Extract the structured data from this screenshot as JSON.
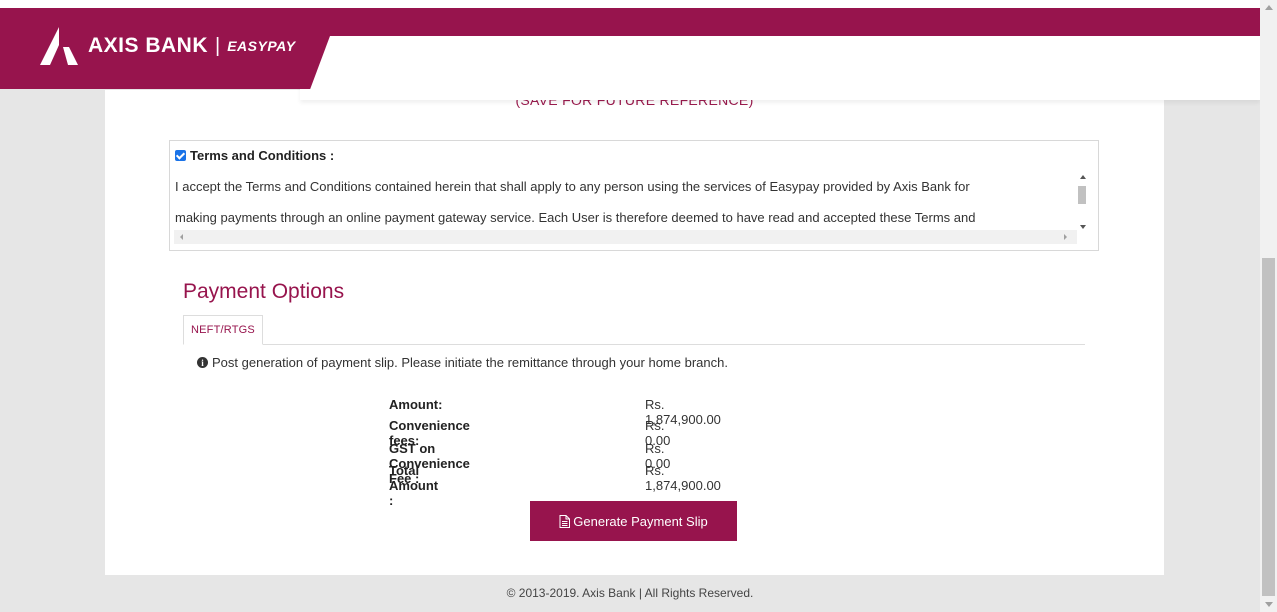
{
  "header": {
    "brand": "AXIS BANK",
    "separator": "|",
    "product": "EASYPAY",
    "brand_color": "#97144d"
  },
  "save_reference": "(SAVE FOR FUTURE REFERENCE)",
  "terms": {
    "checked": true,
    "title": "Terms and Conditions :",
    "lines": [
      "I accept the Terms and Conditions contained herein that shall apply to any person using the services of Easypay provided by Axis Bank for",
      "making payments through an online payment gateway service. Each User is therefore deemed to have read and accepted these Terms and"
    ]
  },
  "payment": {
    "title": "Payment Options",
    "tabs": [
      {
        "label": "NEFT/RTGS",
        "active": true
      }
    ],
    "notice_icon": "info-circle-icon",
    "notice": "Post generation of payment slip. Please initiate the remittance through your home branch.",
    "summary": [
      {
        "label": "Amount:",
        "value": "Rs. 1,874,900.00"
      },
      {
        "label": "Convenience fees:",
        "value": "Rs. 0.00"
      },
      {
        "label": "GST on Convenience Fee :",
        "value": "Rs. 0.00"
      },
      {
        "label": "Total Amount :",
        "value": "Rs. 1,874,900.00"
      }
    ],
    "button_icon": "document-icon",
    "button_label": "Generate Payment Slip"
  },
  "footer": "© 2013-2019. Axis Bank | All Rights Reserved."
}
